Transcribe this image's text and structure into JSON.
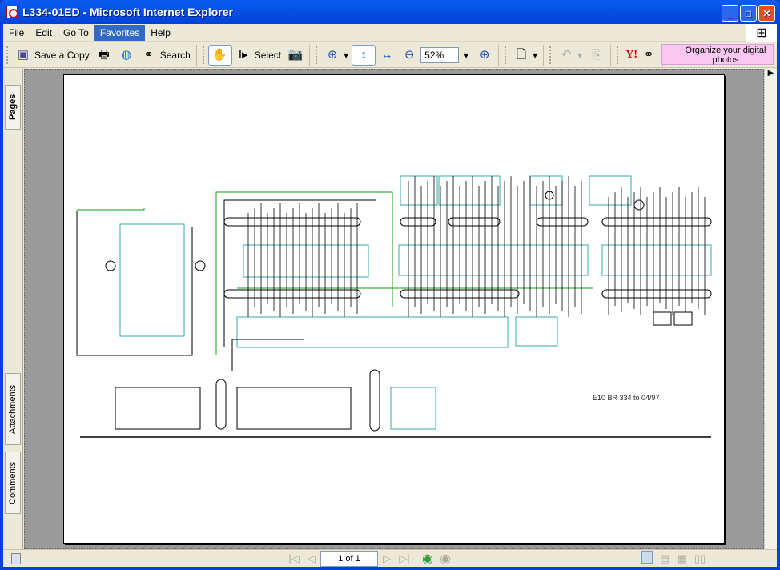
{
  "window": {
    "title": "L334-01ED - Microsoft Internet Explorer"
  },
  "menu": [
    {
      "label": "File"
    },
    {
      "label": "Edit"
    },
    {
      "label": "Go To"
    },
    {
      "label": "Favorites",
      "active": true
    },
    {
      "label": "Help"
    }
  ],
  "toolbar": {
    "save_copy": "Save a Copy",
    "search": "Search",
    "select": "Select",
    "zoom": "52%",
    "ad": "Organize your digital photos",
    "yahoo": "Y!"
  },
  "side_tabs": {
    "pages": "Pages",
    "attachments": "Attachments",
    "comments": "Comments"
  },
  "document": {
    "caption": "E10 BR 334 to 04/97"
  },
  "navigation": {
    "page_indicator": "1 of 1"
  },
  "colors": {
    "titlebar": "#0342d8",
    "menu_active": "#316ac5",
    "diagram_line": "#000000",
    "diagram_box": "#3aa8a8",
    "diagram_green": "#1a9a1a"
  }
}
